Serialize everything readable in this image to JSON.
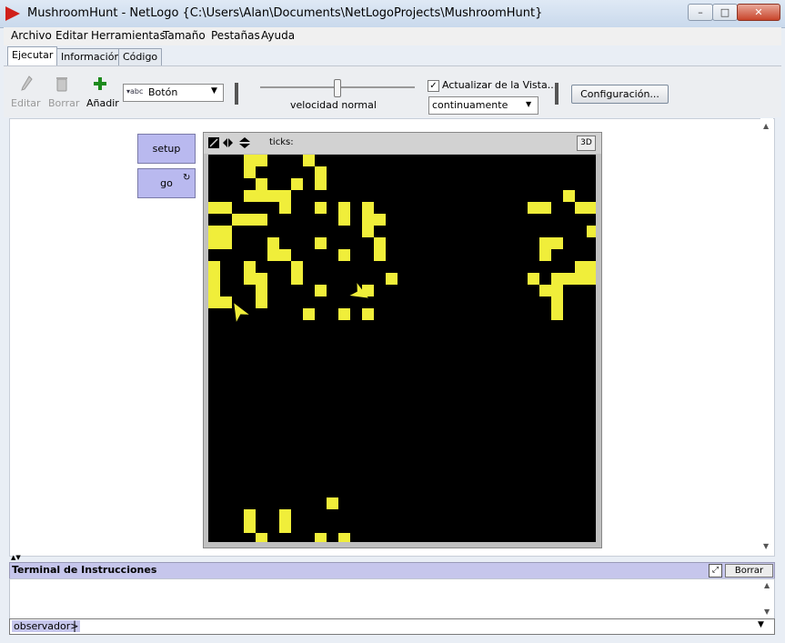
{
  "window": {
    "title": "MushroomHunt - NetLogo {C:\\Users\\Alan\\Documents\\NetLogoProjects\\MushroomHunt}",
    "minimize": "–",
    "maximize": "□",
    "close": "✕"
  },
  "menu": [
    "Archivo",
    "Editar",
    "Herramientas",
    "Tamaño",
    "Pestañas",
    "Ayuda"
  ],
  "tabs": [
    {
      "label": "Ejecutar",
      "active": true
    },
    {
      "label": "Información",
      "active": false
    },
    {
      "label": "Código",
      "active": false
    }
  ],
  "toolbar": {
    "edit_label": "Editar",
    "delete_label": "Borrar",
    "add_label": "Añadir",
    "widget_type": "Botón",
    "speed_label": "velocidad normal",
    "speed_value": 0.5,
    "update_view_label": "Actualizar de la Vista...",
    "update_view_checked": true,
    "update_mode": "continuamente",
    "settings_label": "Configuración..."
  },
  "buttons": {
    "setup": "setup",
    "go": "go"
  },
  "view": {
    "ticks_label": "ticks:",
    "three_d_label": "3D",
    "patch_color": "#f0ee3a",
    "turtle_color": "#f0ee3a",
    "background_color": "#000000",
    "yellow_patches": [
      [
        3,
        0
      ],
      [
        4,
        0
      ],
      [
        8,
        0
      ],
      [
        3,
        1
      ],
      [
        9,
        1
      ],
      [
        4,
        2
      ],
      [
        7,
        2
      ],
      [
        9,
        2
      ],
      [
        3,
        3
      ],
      [
        4,
        3
      ],
      [
        5,
        3
      ],
      [
        6,
        3
      ],
      [
        0,
        4
      ],
      [
        1,
        4
      ],
      [
        6,
        4
      ],
      [
        9,
        4
      ],
      [
        11,
        4
      ],
      [
        13,
        4
      ],
      [
        2,
        5
      ],
      [
        3,
        5
      ],
      [
        4,
        5
      ],
      [
        11,
        5
      ],
      [
        13,
        5
      ],
      [
        14,
        5
      ],
      [
        0,
        6
      ],
      [
        1,
        6
      ],
      [
        13,
        6
      ],
      [
        0,
        7
      ],
      [
        1,
        7
      ],
      [
        5,
        7
      ],
      [
        9,
        7
      ],
      [
        14,
        7
      ],
      [
        5,
        8
      ],
      [
        6,
        8
      ],
      [
        11,
        8
      ],
      [
        14,
        8
      ],
      [
        0,
        9
      ],
      [
        3,
        9
      ],
      [
        7,
        9
      ],
      [
        0,
        10
      ],
      [
        3,
        10
      ],
      [
        4,
        10
      ],
      [
        7,
        10
      ],
      [
        15,
        10
      ],
      [
        0,
        11
      ],
      [
        4,
        11
      ],
      [
        9,
        11
      ],
      [
        13,
        11
      ],
      [
        0,
        12
      ],
      [
        1,
        12
      ],
      [
        4,
        12
      ],
      [
        8,
        13
      ],
      [
        11,
        13
      ],
      [
        13,
        13
      ],
      [
        30,
        3
      ],
      [
        27,
        4
      ],
      [
        28,
        4
      ],
      [
        31,
        4
      ],
      [
        32,
        4
      ],
      [
        32,
        6
      ],
      [
        28,
        7
      ],
      [
        29,
        7
      ],
      [
        28,
        8
      ],
      [
        31,
        9
      ],
      [
        32,
        9
      ],
      [
        27,
        10
      ],
      [
        29,
        10
      ],
      [
        30,
        10
      ],
      [
        31,
        10
      ],
      [
        32,
        10
      ],
      [
        28,
        11
      ],
      [
        29,
        11
      ],
      [
        29,
        12
      ],
      [
        29,
        13
      ],
      [
        10,
        29
      ],
      [
        3,
        30
      ],
      [
        6,
        30
      ],
      [
        3,
        31
      ],
      [
        6,
        31
      ],
      [
        4,
        32
      ],
      [
        9,
        32
      ],
      [
        11,
        32
      ]
    ],
    "turtles": [
      {
        "x": 2.6,
        "y": 13.3,
        "heading": 330
      },
      {
        "x": 12.8,
        "y": 11.7,
        "heading": 120
      }
    ]
  },
  "command_center": {
    "title": "Terminal de Instrucciones",
    "clear_label": "Borrar",
    "prompt": "observador>"
  }
}
